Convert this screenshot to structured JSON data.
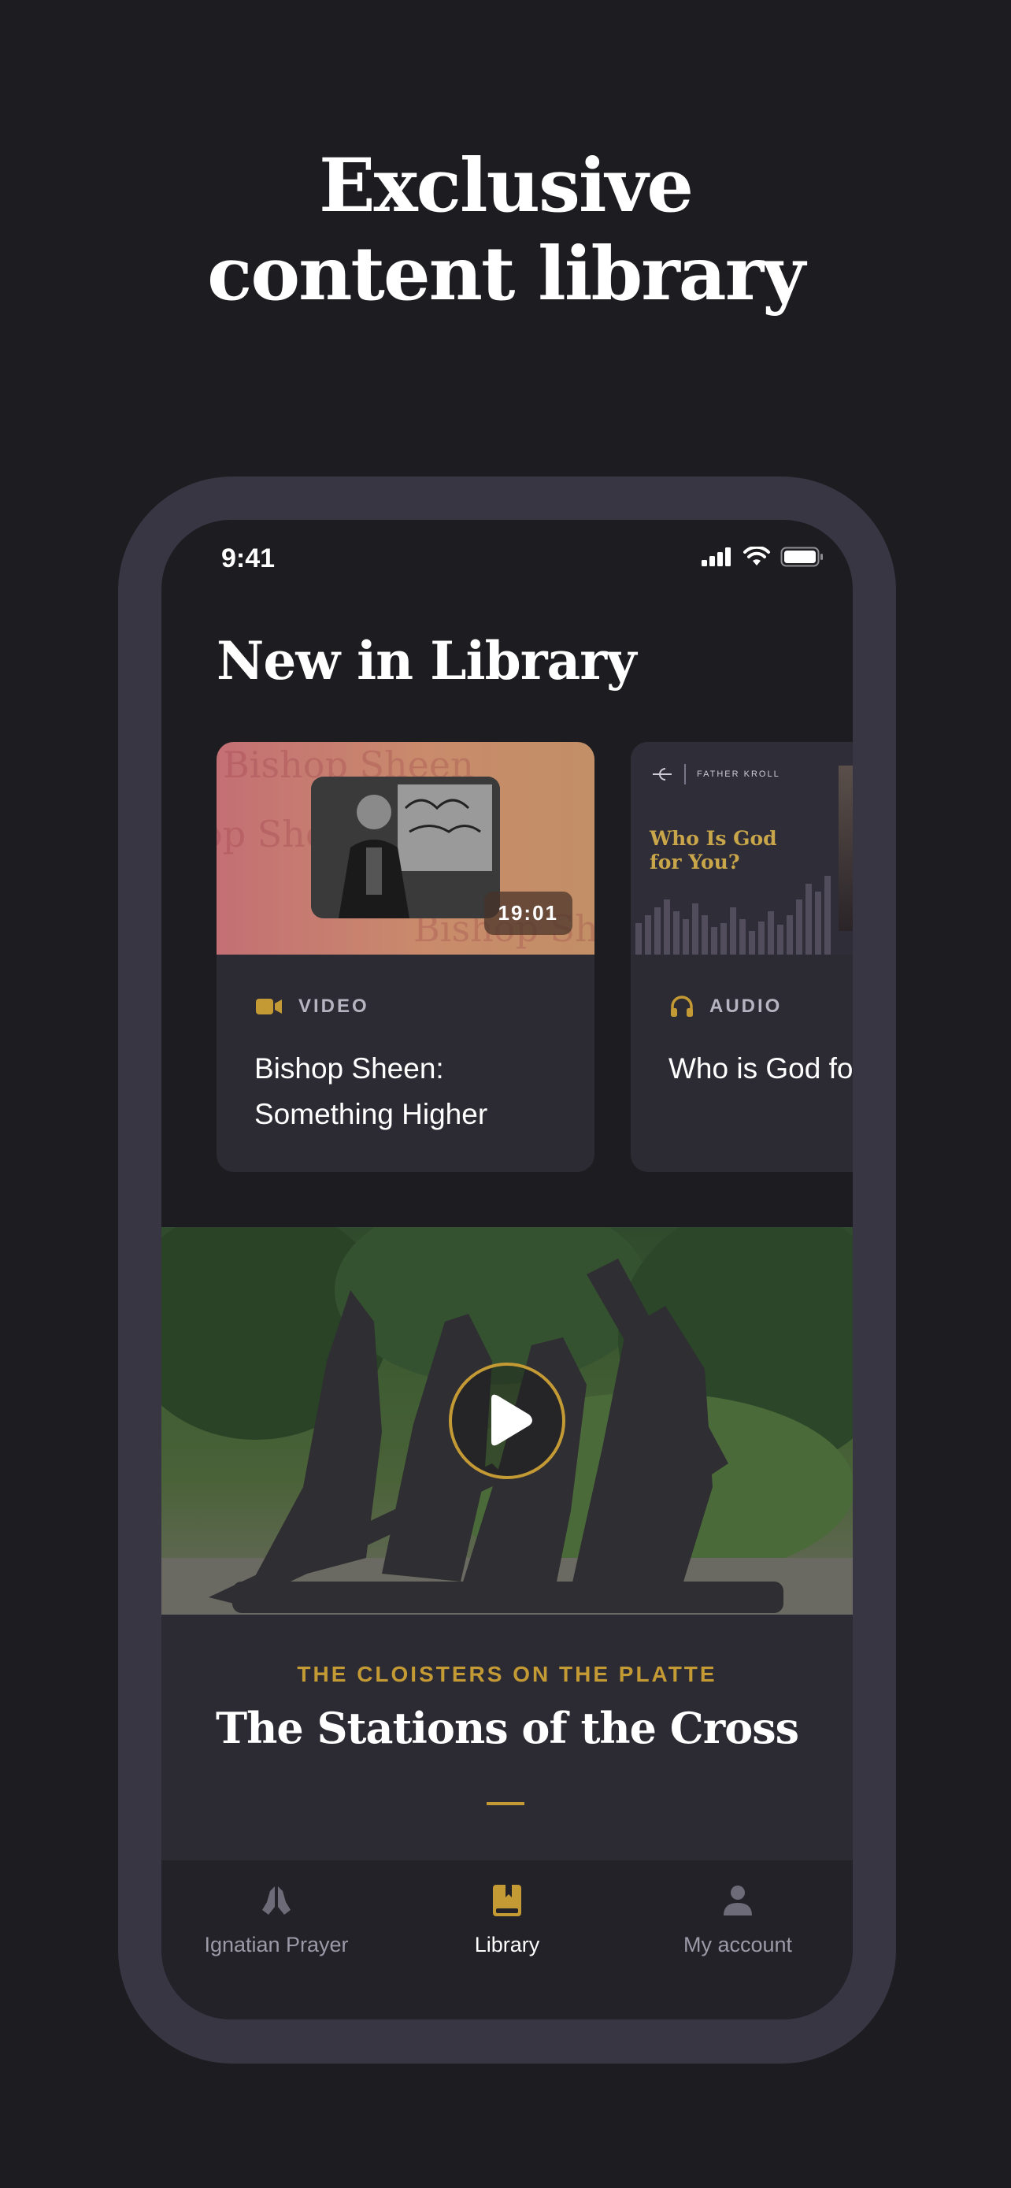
{
  "hero": {
    "title_line1": "Exclusive",
    "title_line2": "content library"
  },
  "status_bar": {
    "time": "9:41"
  },
  "library": {
    "section_title": "New in Library",
    "cards": [
      {
        "type": "VIDEO",
        "type_icon": "video-camera-icon",
        "duration": "19:01",
        "title_line1": "Bishop Sheen:",
        "title_line2": "Something Higher",
        "thumbnail_ghost_text": [
          "Bishop Sheen",
          "op Sheen",
          "Bishop Sheen"
        ]
      },
      {
        "type": "AUDIO",
        "type_icon": "headphones-icon",
        "title_line1": "Who is God fo",
        "thumbnail_brand": "FATHER KROLL",
        "thumbnail_title_line1": "Who Is God",
        "thumbnail_title_line2": "for You?"
      }
    ]
  },
  "featured": {
    "eyebrow": "THE CLOISTERS ON THE PLATTE",
    "title": "The Stations of the Cross",
    "play_icon": "play-icon"
  },
  "tabbar": {
    "tabs": [
      {
        "label": "Ignatian Prayer",
        "icon": "praying-hands-icon",
        "active": false
      },
      {
        "label": "Library",
        "icon": "book-icon",
        "active": true
      },
      {
        "label": "My account",
        "icon": "person-icon",
        "active": false
      }
    ]
  },
  "colors": {
    "background": "#1d1c21",
    "card": "#2c2b33",
    "accent_gold": "#c49a35",
    "frame": "#393644"
  }
}
